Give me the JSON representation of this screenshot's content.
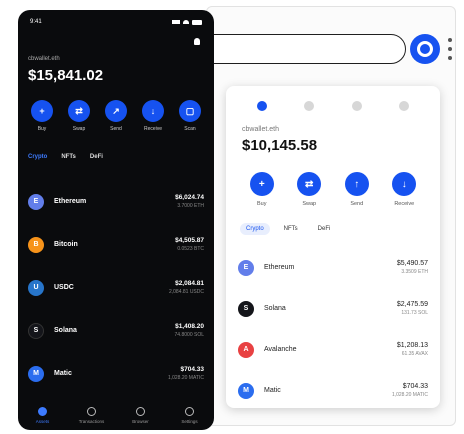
{
  "colors": {
    "brand_blue": "#1652f0",
    "phone_bg": "#0a0b0d"
  },
  "phone": {
    "status_time": "9:41",
    "username": "cbwallet.eth",
    "balance": "$15,841.02",
    "actions": [
      {
        "label": "Buy",
        "icon": "plus-icon",
        "glyph": "+"
      },
      {
        "label": "Swap",
        "icon": "swap-icon",
        "glyph": "⇄"
      },
      {
        "label": "Send",
        "icon": "send-icon",
        "glyph": "↗"
      },
      {
        "label": "Receive",
        "icon": "receive-icon",
        "glyph": "↓"
      },
      {
        "label": "Scan",
        "icon": "scan-icon",
        "glyph": "▢"
      }
    ],
    "tabs": [
      "Crypto",
      "NFTs",
      "DeFi"
    ],
    "assets": [
      {
        "name": "Ethereum",
        "icon": "ethereum-icon",
        "color": "#627eea",
        "fiat": "$6,024.74",
        "amount": "3.7000 ETH"
      },
      {
        "name": "Bitcoin",
        "icon": "bitcoin-icon",
        "color": "#f7931a",
        "fiat": "$4,505.87",
        "amount": "0.0523 BTC"
      },
      {
        "name": "USDC",
        "icon": "usdc-icon",
        "color": "#2775ca",
        "fiat": "$2,084.81",
        "amount": "2,084.81 USDC"
      },
      {
        "name": "Solana",
        "icon": "solana-icon",
        "color": "#14151a",
        "fiat": "$1,408.20",
        "amount": "74.8000 SOL"
      },
      {
        "name": "Matic",
        "icon": "matic-icon",
        "color": "#2b6def",
        "fiat": "$704.33",
        "amount": "1,028.20 MATIC"
      }
    ],
    "nav": [
      "Assets",
      "Transactions",
      "Browser",
      "Settings"
    ]
  },
  "popup": {
    "username": "cbwallet.eth",
    "balance": "$10,145.58",
    "actions": [
      {
        "label": "Buy",
        "icon": "plus-icon",
        "glyph": "+"
      },
      {
        "label": "Swap",
        "icon": "swap-icon",
        "glyph": "⇄"
      },
      {
        "label": "Send",
        "icon": "send-icon",
        "glyph": "↑"
      },
      {
        "label": "Receive",
        "icon": "receive-icon",
        "glyph": "↓"
      }
    ],
    "tabs": [
      "Crypto",
      "NFTs",
      "DeFi"
    ],
    "assets": [
      {
        "name": "Ethereum",
        "icon": "ethereum-icon",
        "color": "#627eea",
        "fiat": "$5,490.57",
        "amount": "3.3509 ETH"
      },
      {
        "name": "Solana",
        "icon": "solana-icon",
        "color": "#14151a",
        "fiat": "$2,475.59",
        "amount": "131.73 SOL"
      },
      {
        "name": "Avalanche",
        "icon": "avalanche-icon",
        "color": "#e84142",
        "fiat": "$1,208.13",
        "amount": "61.35 AVAX"
      },
      {
        "name": "Matic",
        "icon": "matic-icon",
        "color": "#2b6def",
        "fiat": "$704.33",
        "amount": "1,028.20 MATIC"
      }
    ]
  }
}
